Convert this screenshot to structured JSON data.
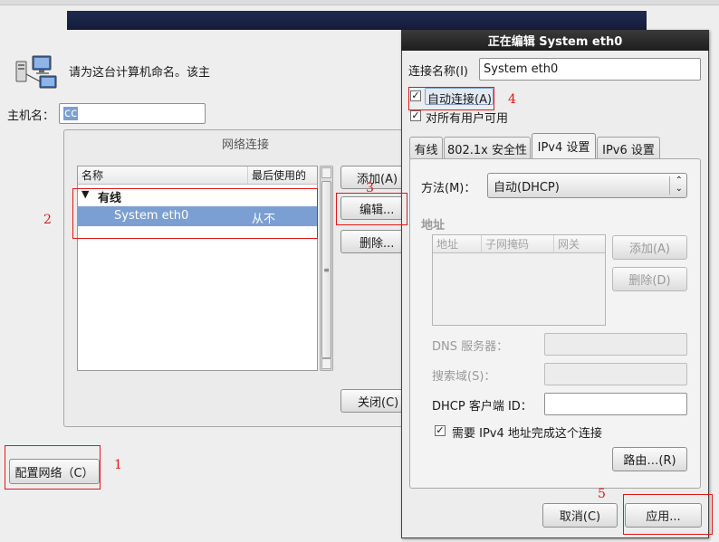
{
  "background_window": {
    "intro_text": "请为这台计算机命名。该主",
    "hostname_label": "主机名：",
    "hostname_value": "cc",
    "configure_network_button": "配置网络（C）"
  },
  "network_connections": {
    "title": "网络连接",
    "columns": [
      "名称",
      "最后使用的"
    ],
    "group_label": "有线",
    "rows": [
      {
        "name": "System eth0",
        "last_used": "从不"
      }
    ],
    "add_button": "添加(A)",
    "edit_button": "编辑...",
    "delete_button": "删除...",
    "close_button": "关闭(C)"
  },
  "edit_dialog": {
    "title": "正在编辑 System eth0",
    "connection_name_label": "连接名称(I)",
    "connection_name_value": "System eth0",
    "auto_connect_label": "自动连接(A)",
    "all_users_label": "对所有用户可用",
    "tabs": [
      "有线",
      "802.1x 安全性",
      "IPv4 设置",
      "IPv6 设置"
    ],
    "method_label": "方法(M)：",
    "method_value": "自动(DHCP)",
    "address_section": "地址",
    "address_columns": [
      "地址",
      "子网掩码",
      "网关"
    ],
    "address_add_button": "添加(A)",
    "address_delete_button": "删除(D)",
    "dns_label": "DNS 服务器：",
    "search_domain_label": "搜索域(S)：",
    "dhcp_client_id_label": "DHCP 客户端 ID：",
    "require_ipv4_label": "需要 IPv4 地址完成这个连接",
    "routes_button": "路由…(R)",
    "cancel_button": "取消(C)",
    "apply_button": "应用..."
  },
  "annotations": [
    "1",
    "2",
    "3",
    "4",
    "5"
  ],
  "colors": {
    "annotation_red": "#e01818",
    "selection_blue": "#7b9fd2",
    "banner_navy": "#1a2346"
  }
}
